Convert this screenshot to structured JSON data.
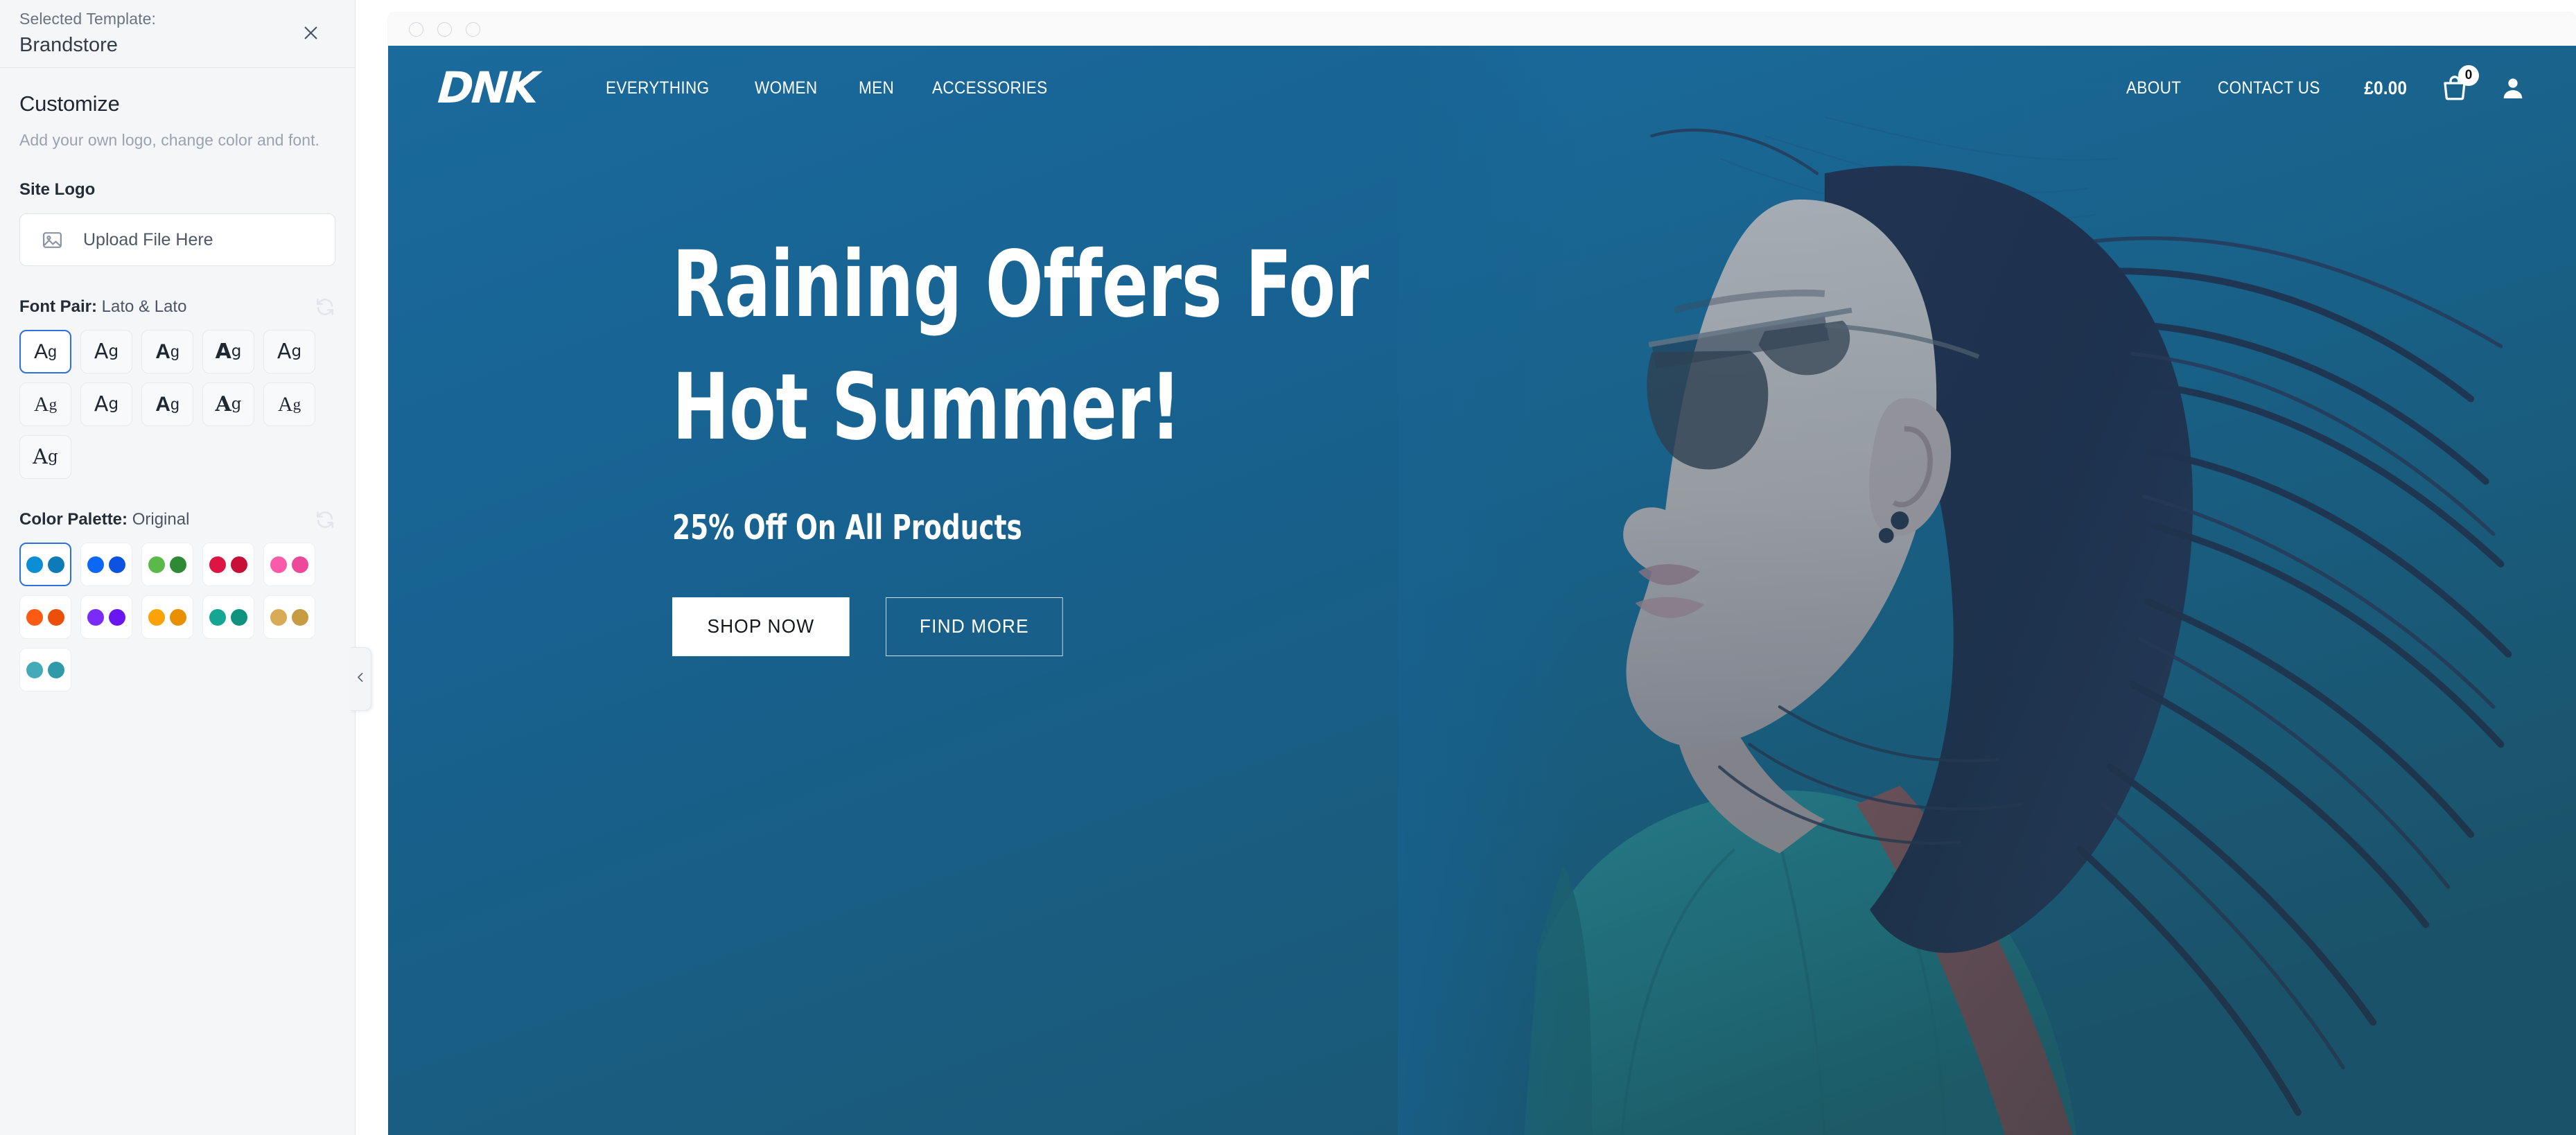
{
  "sidebar": {
    "selected_template_label": "Selected Template:",
    "selected_template_name": "Brandstore",
    "close_icon": "close-icon",
    "customize_title": "Customize",
    "customize_subtitle": "Add your own logo, change color and font.",
    "site_logo_label": "Site Logo",
    "upload_placeholder": "Upload File Here",
    "upload_icon": "image-icon",
    "font_pair": {
      "label": "Font Pair:",
      "value": "Lato & Lato",
      "reset_icon": "refresh-icon",
      "sample": "Ag",
      "tiles": [
        {
          "a": "A",
          "g": "g",
          "class": "f-sans",
          "bold": false,
          "selected": true
        },
        {
          "a": "A",
          "g": "g",
          "class": "f-sans2",
          "bold": false,
          "selected": false
        },
        {
          "a": "A",
          "g": "g",
          "class": "f-sans",
          "bold": true,
          "selected": false
        },
        {
          "a": "A",
          "g": "g",
          "class": "f-sans2",
          "bold": true,
          "selected": false
        },
        {
          "a": "A",
          "g": "g",
          "class": "f-sans2",
          "bold": false,
          "selected": false
        },
        {
          "a": "A",
          "g": "g",
          "class": "f-serif",
          "bold": false,
          "selected": false
        },
        {
          "a": "A",
          "g": "g",
          "class": "f-sans2",
          "bold": false,
          "selected": false
        },
        {
          "a": "A",
          "g": "g",
          "class": "f-sans",
          "bold": true,
          "selected": false
        },
        {
          "a": "A",
          "g": "g",
          "class": "f-serif2",
          "bold": true,
          "selected": false
        },
        {
          "a": "A",
          "g": "g",
          "class": "f-serif",
          "bold": false,
          "selected": false
        },
        {
          "a": "A",
          "g": "g",
          "class": "f-serif2",
          "bold": false,
          "selected": false
        }
      ]
    },
    "color_palette": {
      "label": "Color Palette:",
      "value": "Original",
      "reset_icon": "refresh-icon",
      "tiles": [
        {
          "name": "original",
          "c1": "#0b8ed6",
          "c2": "#0d7bb8",
          "selected": true
        },
        {
          "name": "blue",
          "c1": "#0b68f5",
          "c2": "#0b53e0",
          "selected": false
        },
        {
          "name": "green",
          "c1": "#5bb94a",
          "c2": "#2f8a35",
          "selected": false
        },
        {
          "name": "red",
          "c1": "#dc1543",
          "c2": "#c71038",
          "selected": false
        },
        {
          "name": "pink",
          "c1": "#fb5ba8",
          "c2": "#ec499a",
          "selected": false
        },
        {
          "name": "orange",
          "c1": "#fd5a14",
          "c2": "#eb4f09",
          "selected": false
        },
        {
          "name": "purple",
          "c1": "#7a2bf7",
          "c2": "#6a16f0",
          "selected": false
        },
        {
          "name": "amber",
          "c1": "#fba209",
          "c2": "#e89000",
          "selected": false
        },
        {
          "name": "teal",
          "c1": "#15a593",
          "c2": "#10927f",
          "selected": false
        },
        {
          "name": "gold",
          "c1": "#d9ab56",
          "c2": "#c69b42",
          "selected": false
        },
        {
          "name": "cyan",
          "c1": "#43abb7",
          "c2": "#2f9aa8",
          "selected": false
        }
      ]
    },
    "collapse_icon": "chevron-left-icon"
  },
  "browser": {
    "dots": [
      "window-dot",
      "window-dot",
      "window-dot"
    ]
  },
  "site": {
    "logo": "DNK",
    "nav_left": [
      {
        "label": "EVERYTHING"
      },
      {
        "label": "WOMEN"
      },
      {
        "label": "MEN"
      },
      {
        "label": "ACCESSORIES"
      }
    ],
    "nav_right": [
      {
        "label": "ABOUT"
      },
      {
        "label": "CONTACT US"
      }
    ],
    "cart_price": "£0.00",
    "cart_count": "0",
    "cart_icon": "shopping-bag-icon",
    "account_icon": "user-icon",
    "hero": {
      "heading": "Raining Offers For\nHot Summer!",
      "subheading": "25% Off On All Products",
      "primary_button": "SHOP NOW",
      "secondary_button": "FIND MORE"
    },
    "colors": {
      "hero_top": "#1a6a9c",
      "hero_bottom": "#1a5369",
      "accent": "#0b8ed6"
    }
  }
}
